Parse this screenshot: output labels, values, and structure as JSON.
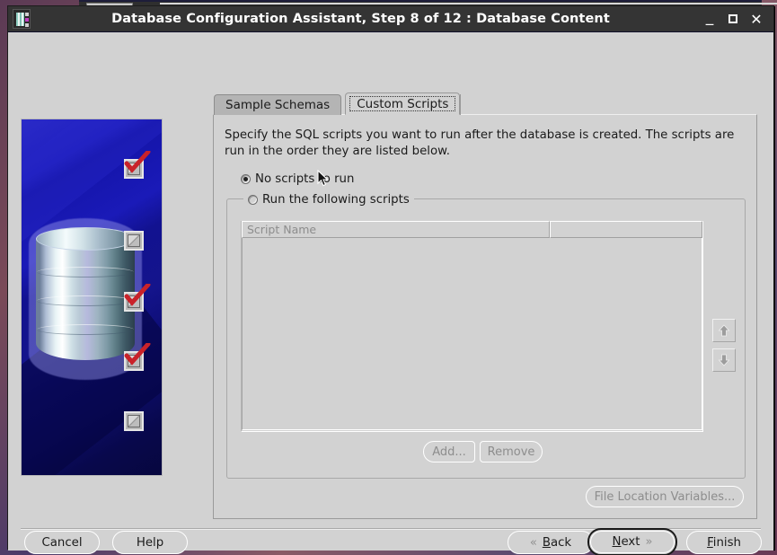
{
  "window": {
    "title": "Database Configuration Assistant, Step 8 of 12 : Database Content",
    "icon_name": "oracle-dbca-icon",
    "controls": {
      "minimize": "_",
      "maximize": "□",
      "close": "✕"
    }
  },
  "tabs": [
    {
      "label": "Sample Schemas",
      "active": false
    },
    {
      "label": "Custom Scripts",
      "active": true
    }
  ],
  "content": {
    "description": "Specify the SQL scripts you want to run after the database is created. The scripts are run in the order they are listed below.",
    "radio_no_scripts": {
      "label": "No scripts to run",
      "selected": true
    },
    "radio_run_scripts": {
      "label": "Run the following scripts",
      "selected": false
    },
    "table": {
      "columns": [
        "Script Name",
        ""
      ],
      "rows": []
    },
    "reorder": {
      "move_up_icon": "arrow-up-icon",
      "move_down_icon": "arrow-down-icon"
    },
    "add_label": "Add...",
    "remove_label": "Remove",
    "file_location_variables_label": "File Location Variables..."
  },
  "footer": {
    "cancel": "Cancel",
    "help": "Help",
    "back": "Back",
    "back_mnemonic": "B",
    "next": "Next",
    "next_mnemonic": "N",
    "finish": "Finish",
    "finish_mnemonic": "F",
    "back_chevron": "«",
    "next_chevron": "»"
  },
  "sidebar": {
    "alt": "database-illustration",
    "checkmarks": [
      true,
      false,
      true,
      true,
      false
    ]
  },
  "colors": {
    "window_bg": "#d2d2d2",
    "titlebar_bg": "#343434",
    "title_fg": "#ffffff",
    "disabled_fg": "#8d8d8d",
    "text_fg": "#1b1b1b",
    "check_red": "#c9222a",
    "art_blue": "#1414a8"
  }
}
